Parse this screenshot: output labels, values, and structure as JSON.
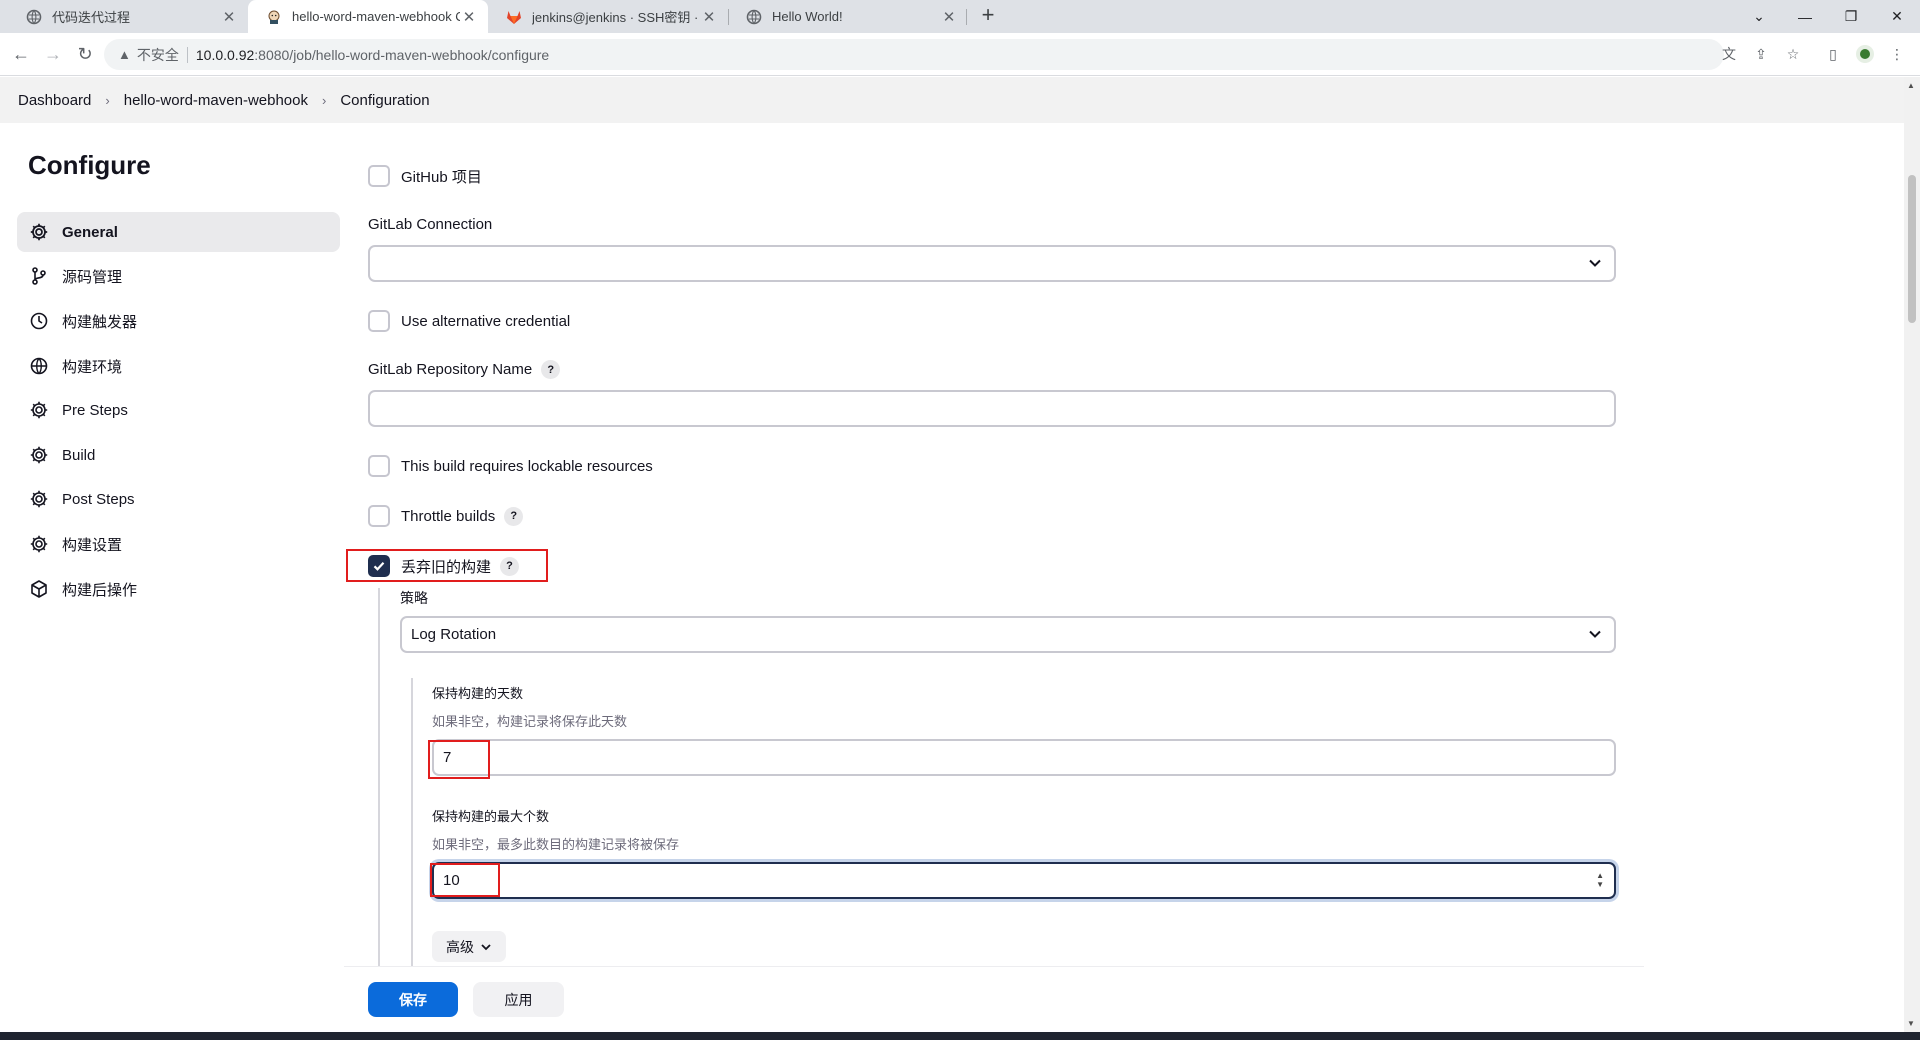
{
  "browser": {
    "tabs": [
      {
        "title": "代码迭代过程",
        "active": false
      },
      {
        "title": "hello-word-maven-webhook C",
        "active": true
      },
      {
        "title": "jenkins@jenkins · SSH密钥 · 用",
        "active": false
      },
      {
        "title": "Hello World!",
        "active": false
      }
    ],
    "new_tab": "+",
    "address": {
      "security_label": "不安全",
      "host": "10.0.0.92",
      "path": ":8080/job/hello-word-maven-webhook/configure"
    }
  },
  "breadcrumb": {
    "items": [
      "Dashboard",
      "hello-word-maven-webhook",
      "Configuration"
    ]
  },
  "sidebar": {
    "title": "Configure",
    "items": [
      {
        "label": "General",
        "icon": "gear-icon",
        "active": true
      },
      {
        "label": "源码管理",
        "icon": "branch-icon",
        "active": false
      },
      {
        "label": "构建触发器",
        "icon": "clock-icon",
        "active": false
      },
      {
        "label": "构建环境",
        "icon": "globe-icon",
        "active": false
      },
      {
        "label": "Pre Steps",
        "icon": "gear-icon",
        "active": false
      },
      {
        "label": "Build",
        "icon": "gear-icon",
        "active": false
      },
      {
        "label": "Post Steps",
        "icon": "gear-icon",
        "active": false
      },
      {
        "label": "构建设置",
        "icon": "gear-icon",
        "active": false
      },
      {
        "label": "构建后操作",
        "icon": "cube-icon",
        "active": false
      }
    ]
  },
  "form": {
    "github_project": {
      "label": "GitHub 项目",
      "checked": false
    },
    "gitlab_connection": {
      "label": "GitLab Connection",
      "value": ""
    },
    "alt_credential": {
      "label": "Use alternative credential",
      "checked": false
    },
    "gitlab_repo_name": {
      "label": "GitLab Repository Name",
      "help": "?",
      "value": ""
    },
    "lockable": {
      "label": "This build requires lockable resources",
      "checked": false
    },
    "throttle": {
      "label": "Throttle builds",
      "help": "?",
      "checked": false
    },
    "discard_old": {
      "label": "丢弃旧的构建",
      "help": "?",
      "checked": true
    },
    "strategy": {
      "label": "策略",
      "value": "Log Rotation"
    },
    "days_to_keep": {
      "label": "保持构建的天数",
      "desc": "如果非空，构建记录将保存此天数",
      "value": "7"
    },
    "max_builds": {
      "label": "保持构建的最大个数",
      "desc": "如果非空，最多此数目的构建记录将被保存",
      "value": "10"
    },
    "advanced": {
      "label": "高级"
    }
  },
  "actions": {
    "save": "保存",
    "apply": "应用"
  },
  "colors": {
    "primary": "#0b6bdb",
    "checked": "#1f2e4f",
    "highlight": "#e11d1d"
  }
}
